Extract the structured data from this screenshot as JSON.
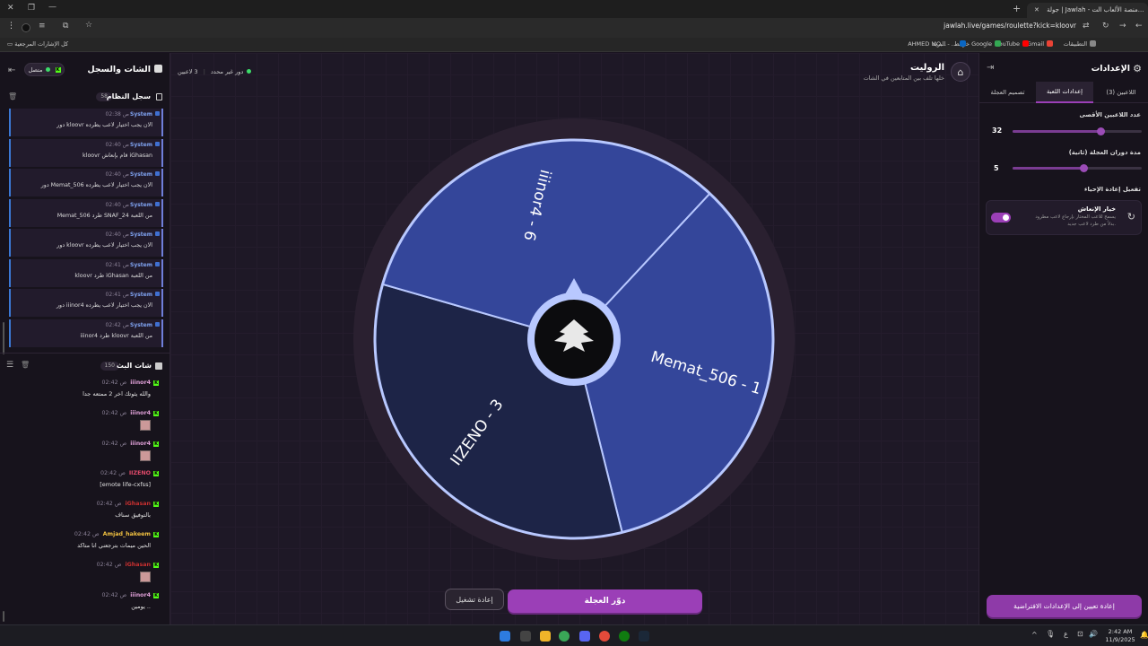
{
  "browser": {
    "tab_title": "جولة | Jawlah - منصة الألعاب الت...",
    "url": "jawlah.live/games/roulette?kick=kloovr",
    "bookmarks": [
      {
        "label": "التطبيقات",
        "color": "#888888"
      },
      {
        "label": "Gmail",
        "color": "#ea4335"
      },
      {
        "label": "YouTube",
        "color": "#ff0000"
      },
      {
        "label": "خرائط Google",
        "color": "#34a853"
      },
      {
        "label": "البريد - ...",
        "color": "#0a66c2"
      },
      {
        "label": "AHMED MO...",
        "color": "#4a90e2"
      }
    ],
    "all_bookmarks_label": "كل الإشارات المرجعية"
  },
  "header": {
    "title": "الروليت",
    "subtitle": "خلها تلف بين المتابعين في الشات",
    "players_count": "3 لاعبين",
    "round_status": "دور غير محدد"
  },
  "chat_panel": {
    "title": "الشات والسجل",
    "status_label": "متصل",
    "system_log_title": "سجل النظام",
    "system_log_count": "58",
    "system_messages": [
      {
        "who": "System",
        "time": "02:38 ص",
        "text": "دور kloovr الان يجب اختيار لاعب يطرده"
      },
      {
        "who": "System",
        "time": "02:40 ص",
        "text": "kloovr قام بإنعاش iGhasan"
      },
      {
        "who": "System",
        "time": "02:40 ص",
        "text": "دور Memat_506 الان يجب اختيار لاعب يطرده"
      },
      {
        "who": "System",
        "time": "02:40 ص",
        "text": "Memat_506 طرد SNAF_24 من اللعبة"
      },
      {
        "who": "System",
        "time": "02:40 ص",
        "text": "دور kloovr الان يجب اختيار لاعب يطرده"
      },
      {
        "who": "System",
        "time": "02:41 ص",
        "text": "kloovr طرد iGhasan من اللعبة"
      },
      {
        "who": "System",
        "time": "02:41 ص",
        "text": "دور iiinor4 الان يجب اختيار لاعب يطرده"
      },
      {
        "who": "System",
        "time": "02:42 ص",
        "text": "iiinor4 طرد kloovr من اللعبة"
      }
    ],
    "live_chat_title": "شات البث",
    "live_chat_count": "150",
    "chat_messages": [
      {
        "user": "iiinor4",
        "color": "#e0a0d8",
        "time": "02:42 ص",
        "text": "والله يثوتك اخر 2 ممتعه جدا",
        "thumb": false
      },
      {
        "user": "iiinor4",
        "color": "#e0a0d8",
        "time": "02:42 ص",
        "text": "",
        "thumb": true
      },
      {
        "user": "iiinor4",
        "color": "#e0a0d8",
        "time": "02:42 ص",
        "text": "",
        "thumb": true
      },
      {
        "user": "IIZENO",
        "color": "#e04a6a",
        "time": "02:42 ص",
        "text": "[emote life-cxfss]",
        "thumb": false
      },
      {
        "user": "iGhasan",
        "color": "#c83030",
        "time": "02:42 ص",
        "text": "بالتوفيق سناف",
        "thumb": false
      },
      {
        "user": "Amjad_hakeem",
        "color": "#f0c040",
        "time": "02:42 ص",
        "text": "الحين ميمات بترجعني انا متاكد",
        "thumb": false
      },
      {
        "user": "iGhasan",
        "color": "#c83030",
        "time": "02:42 ص",
        "text": "",
        "thumb": true
      },
      {
        "user": "iiinor4",
        "color": "#e0a0d8",
        "time": "02:42 ص",
        "text": "يومين ..",
        "thumb": false
      }
    ]
  },
  "settings_panel": {
    "title": "الإعدادات",
    "tabs": [
      "اللاعبين (3)",
      "إعدادات اللعبة",
      "تصميم العجلة"
    ],
    "active_tab": 1,
    "max_players_label": "عدد اللاعبين الأقصى",
    "max_players_value": "32",
    "max_players_fraction": 0.68,
    "spin_duration_label": "مدة دوران العجلة (ثانية)",
    "spin_duration_value": "5",
    "spin_duration_fraction": 0.55,
    "revive_section_label": "تفعيل إعادة الإحياء",
    "revive_option_title": "خيار الإنعاش",
    "revive_option_desc_1": "يسمح للاعب المختار بإرجاع لاعب مطرود",
    "revive_option_desc_2": "بدلاً من طرد لاعب جديد.",
    "revive_enabled": true,
    "reset_defaults_label": "إعادة تعيين إلى الإعدادات الافتراضية"
  },
  "wheel": {
    "segments": [
      {
        "label": "Memat_506 - 1",
        "color": "#34469a"
      },
      {
        "label": "IIZENO - 3",
        "color": "#1d2447"
      },
      {
        "label": "iiinor4 - 6",
        "color": "#34469a"
      }
    ]
  },
  "controls": {
    "spin_label": "دوّر العجلة",
    "reset_label": "إعادة تشغيل"
  },
  "taskbar": {
    "time": "2:42 AM",
    "date": "11/9/2025",
    "lang": "ع"
  },
  "colors": {
    "accent": "#9b3fb7",
    "kick_green": "#53fc18",
    "wheel_border": "#b8c8ff"
  }
}
